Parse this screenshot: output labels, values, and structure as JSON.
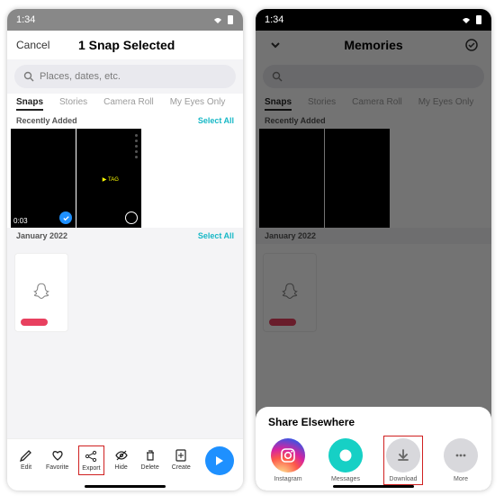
{
  "status_time": "1:34",
  "left": {
    "cancel": "Cancel",
    "title": "1 Snap Selected",
    "search_placeholder": "Places, dates, etc.",
    "tabs": [
      "Snaps",
      "Stories",
      "Camera Roll",
      "My Eyes Only"
    ],
    "sections": {
      "recently": {
        "label": "Recently Added",
        "action": "Select All"
      },
      "january": {
        "label": "January 2022",
        "action": "Select All"
      }
    },
    "thumb_duration": "0:03",
    "thumb_tag": "TAG",
    "toolbar": {
      "edit": "Edit",
      "favorite": "Favorite",
      "export": "Export",
      "hide": "Hide",
      "delete": "Delete",
      "create": "Create"
    }
  },
  "right": {
    "memories_title": "Memories",
    "share_title": "Share Elsewhere",
    "options": {
      "instagram": "Instagram",
      "messages": "Messages",
      "download": "Download",
      "more": "More"
    }
  }
}
